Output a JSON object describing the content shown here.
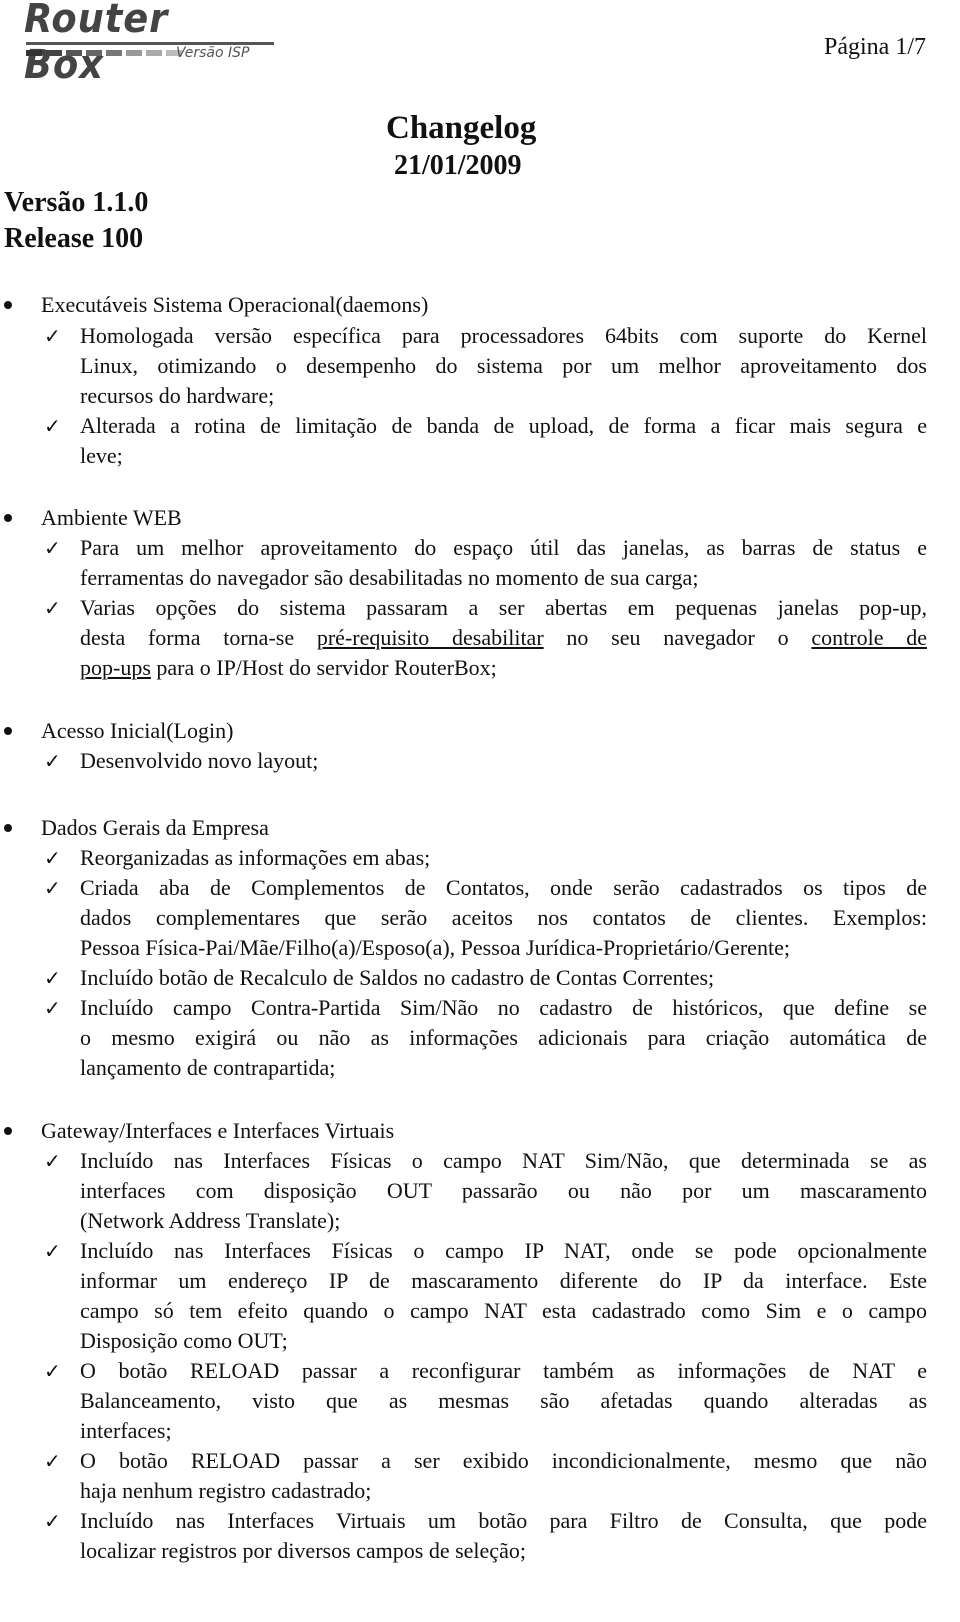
{
  "header": {
    "logo_title": "Router Box",
    "logo_subtitle": "Versão ISP",
    "page_label": "Página 1/7"
  },
  "document": {
    "title": "Changelog",
    "date": "21/01/2009",
    "version": "Versão 1.1.0",
    "release": "Release 100"
  },
  "icons": {
    "bullet": "bullet-icon",
    "check": "checkmark-icon"
  },
  "sections": [
    {
      "title": "Executáveis Sistema Operacional(daemons)",
      "items": [
        [
          "Homologada versão específica para processadores 64bits com suporte do Kernel",
          "Linux, otimizando o desempenho do sistema por um melhor aproveitamento dos",
          "recursos do hardware;"
        ],
        [
          "Alterada a rotina de limitação de banda de upload, de forma a ficar mais segura e",
          "leve;"
        ]
      ]
    },
    {
      "title": "Ambiente WEB",
      "items": [
        [
          "Para um melhor aproveitamento do espaço útil das janelas, as barras de status e",
          "ferramentas do navegador são desabilitadas no momento de sua carga;"
        ],
        [
          "Varias opções do sistema passaram a ser abertas em pequenas janelas pop-up,",
          "desta forma torna-se ",
          "pré-requisito desabilitar",
          " no seu navegador o ",
          "controle de",
          "pop-ups",
          " para o IP/Host do servidor RouterBox;"
        ]
      ]
    },
    {
      "title": "Acesso Inicial(Login)",
      "items": [
        [
          "Desenvolvido novo layout;"
        ]
      ]
    },
    {
      "title": "Dados Gerais da Empresa",
      "items": [
        [
          "Reorganizadas as informações em abas;"
        ],
        [
          "Criada aba de Complementos de Contatos, onde serão cadastrados os tipos de",
          "dados complementares que serão aceitos nos contatos de clientes. Exemplos:",
          "Pessoa Física-Pai/Mãe/Filho(a)/Esposo(a), Pessoa Jurídica-Proprietário/Gerente;"
        ],
        [
          "Incluído botão de Recalculo de Saldos no cadastro de Contas Correntes;"
        ],
        [
          "Incluído campo Contra-Partida Sim/Não no cadastro de históricos, que define se",
          "o mesmo exigirá ou não as informações adicionais para criação automática de",
          "lançamento de contrapartida;"
        ]
      ]
    },
    {
      "title": "Gateway/Interfaces e Interfaces Virtuais",
      "items": [
        [
          "Incluído nas Interfaces Físicas o campo NAT Sim/Não, que determinada se as",
          "interfaces com disposição OUT passarão ou não por um mascaramento",
          "(Network Address Translate);"
        ],
        [
          "Incluído nas Interfaces Físicas o campo IP NAT, onde se pode opcionalmente",
          "informar um endereço IP de mascaramento diferente do IP da interface. Este",
          "campo só tem efeito quando o campo NAT esta cadastrado como Sim e o campo",
          "Disposição como OUT;"
        ],
        [
          "O botão RELOAD passar a reconfigurar também as informações de NAT e",
          "Balanceamento, visto que as mesmas são afetadas quando alteradas as",
          "interfaces;"
        ],
        [
          "O botão RELOAD passar a ser exibido incondicionalmente, mesmo que não",
          "haja nenhum registro cadastrado;"
        ],
        [
          "Incluído nas Interfaces Virtuais um botão para Filtro de Consulta, que pode",
          "localizar registros por diversos campos de seleção;"
        ]
      ]
    }
  ]
}
